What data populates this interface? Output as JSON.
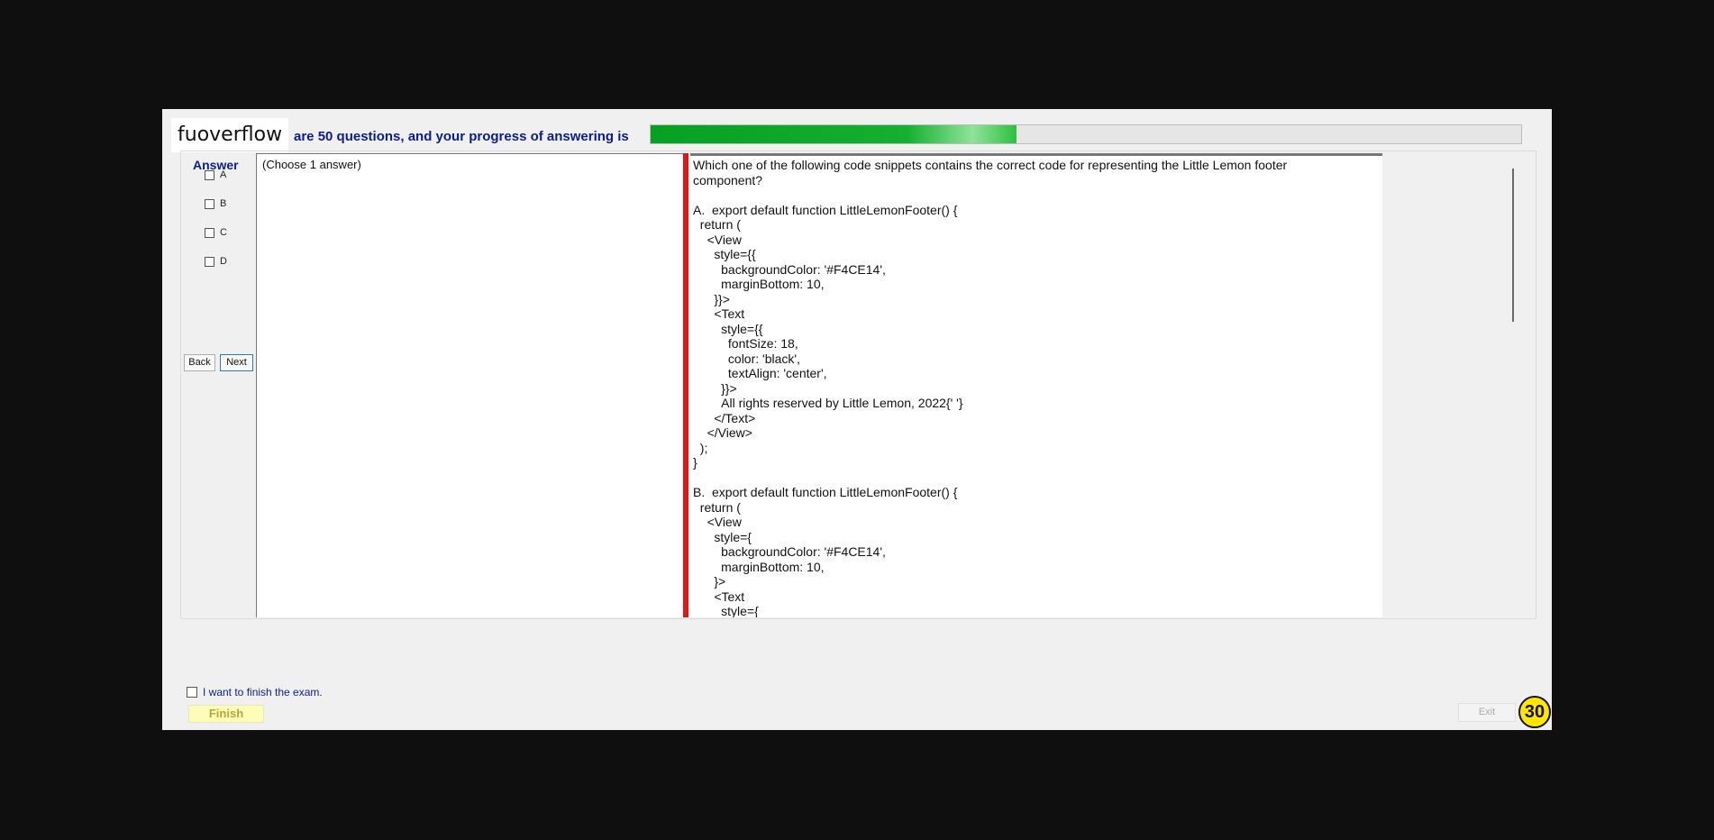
{
  "header": {
    "logo_text": "fuoverflow",
    "progress_label": "are 50 questions, and your progress of answering is",
    "progress_fraction": 0.42,
    "progress_color": "#06a022"
  },
  "answer_panel": {
    "title": "Answer",
    "options": [
      "A",
      "B",
      "C",
      "D"
    ],
    "back_label": "Back",
    "next_label": "Next"
  },
  "choose_panel": {
    "text": "(Choose 1 answer)"
  },
  "question": {
    "text": "Which one of the following code snippets contains the correct code for representing the Little Lemon footer\ncomponent?\n\nA.  export default function LittleLemonFooter() {\n  return (\n    <View\n      style={{\n        backgroundColor: '#F4CE14',\n        marginBottom: 10,\n      }}>\n      <Text\n        style={{\n          fontSize: 18,\n          color: 'black',\n          textAlign: 'center',\n        }}>\n        All rights reserved by Little Lemon, 2022{' '}\n      </Text>\n    </View>\n  );\n}\n\nB.  export default function LittleLemonFooter() {\n  return (\n    <View\n      style={\n        backgroundColor: '#F4CE14',\n        marginBottom: 10,\n      }>\n      <Text\n        style={"
  },
  "footer": {
    "finish_checkbox_label": "I want to finish the exam.",
    "finish_label": "Finish",
    "exit_label": "Exit",
    "timer": "30"
  },
  "colors": {
    "accent_blue": "#0c1c8c",
    "divider_red": "#d61b1b",
    "timer_yellow": "#ffe600"
  }
}
